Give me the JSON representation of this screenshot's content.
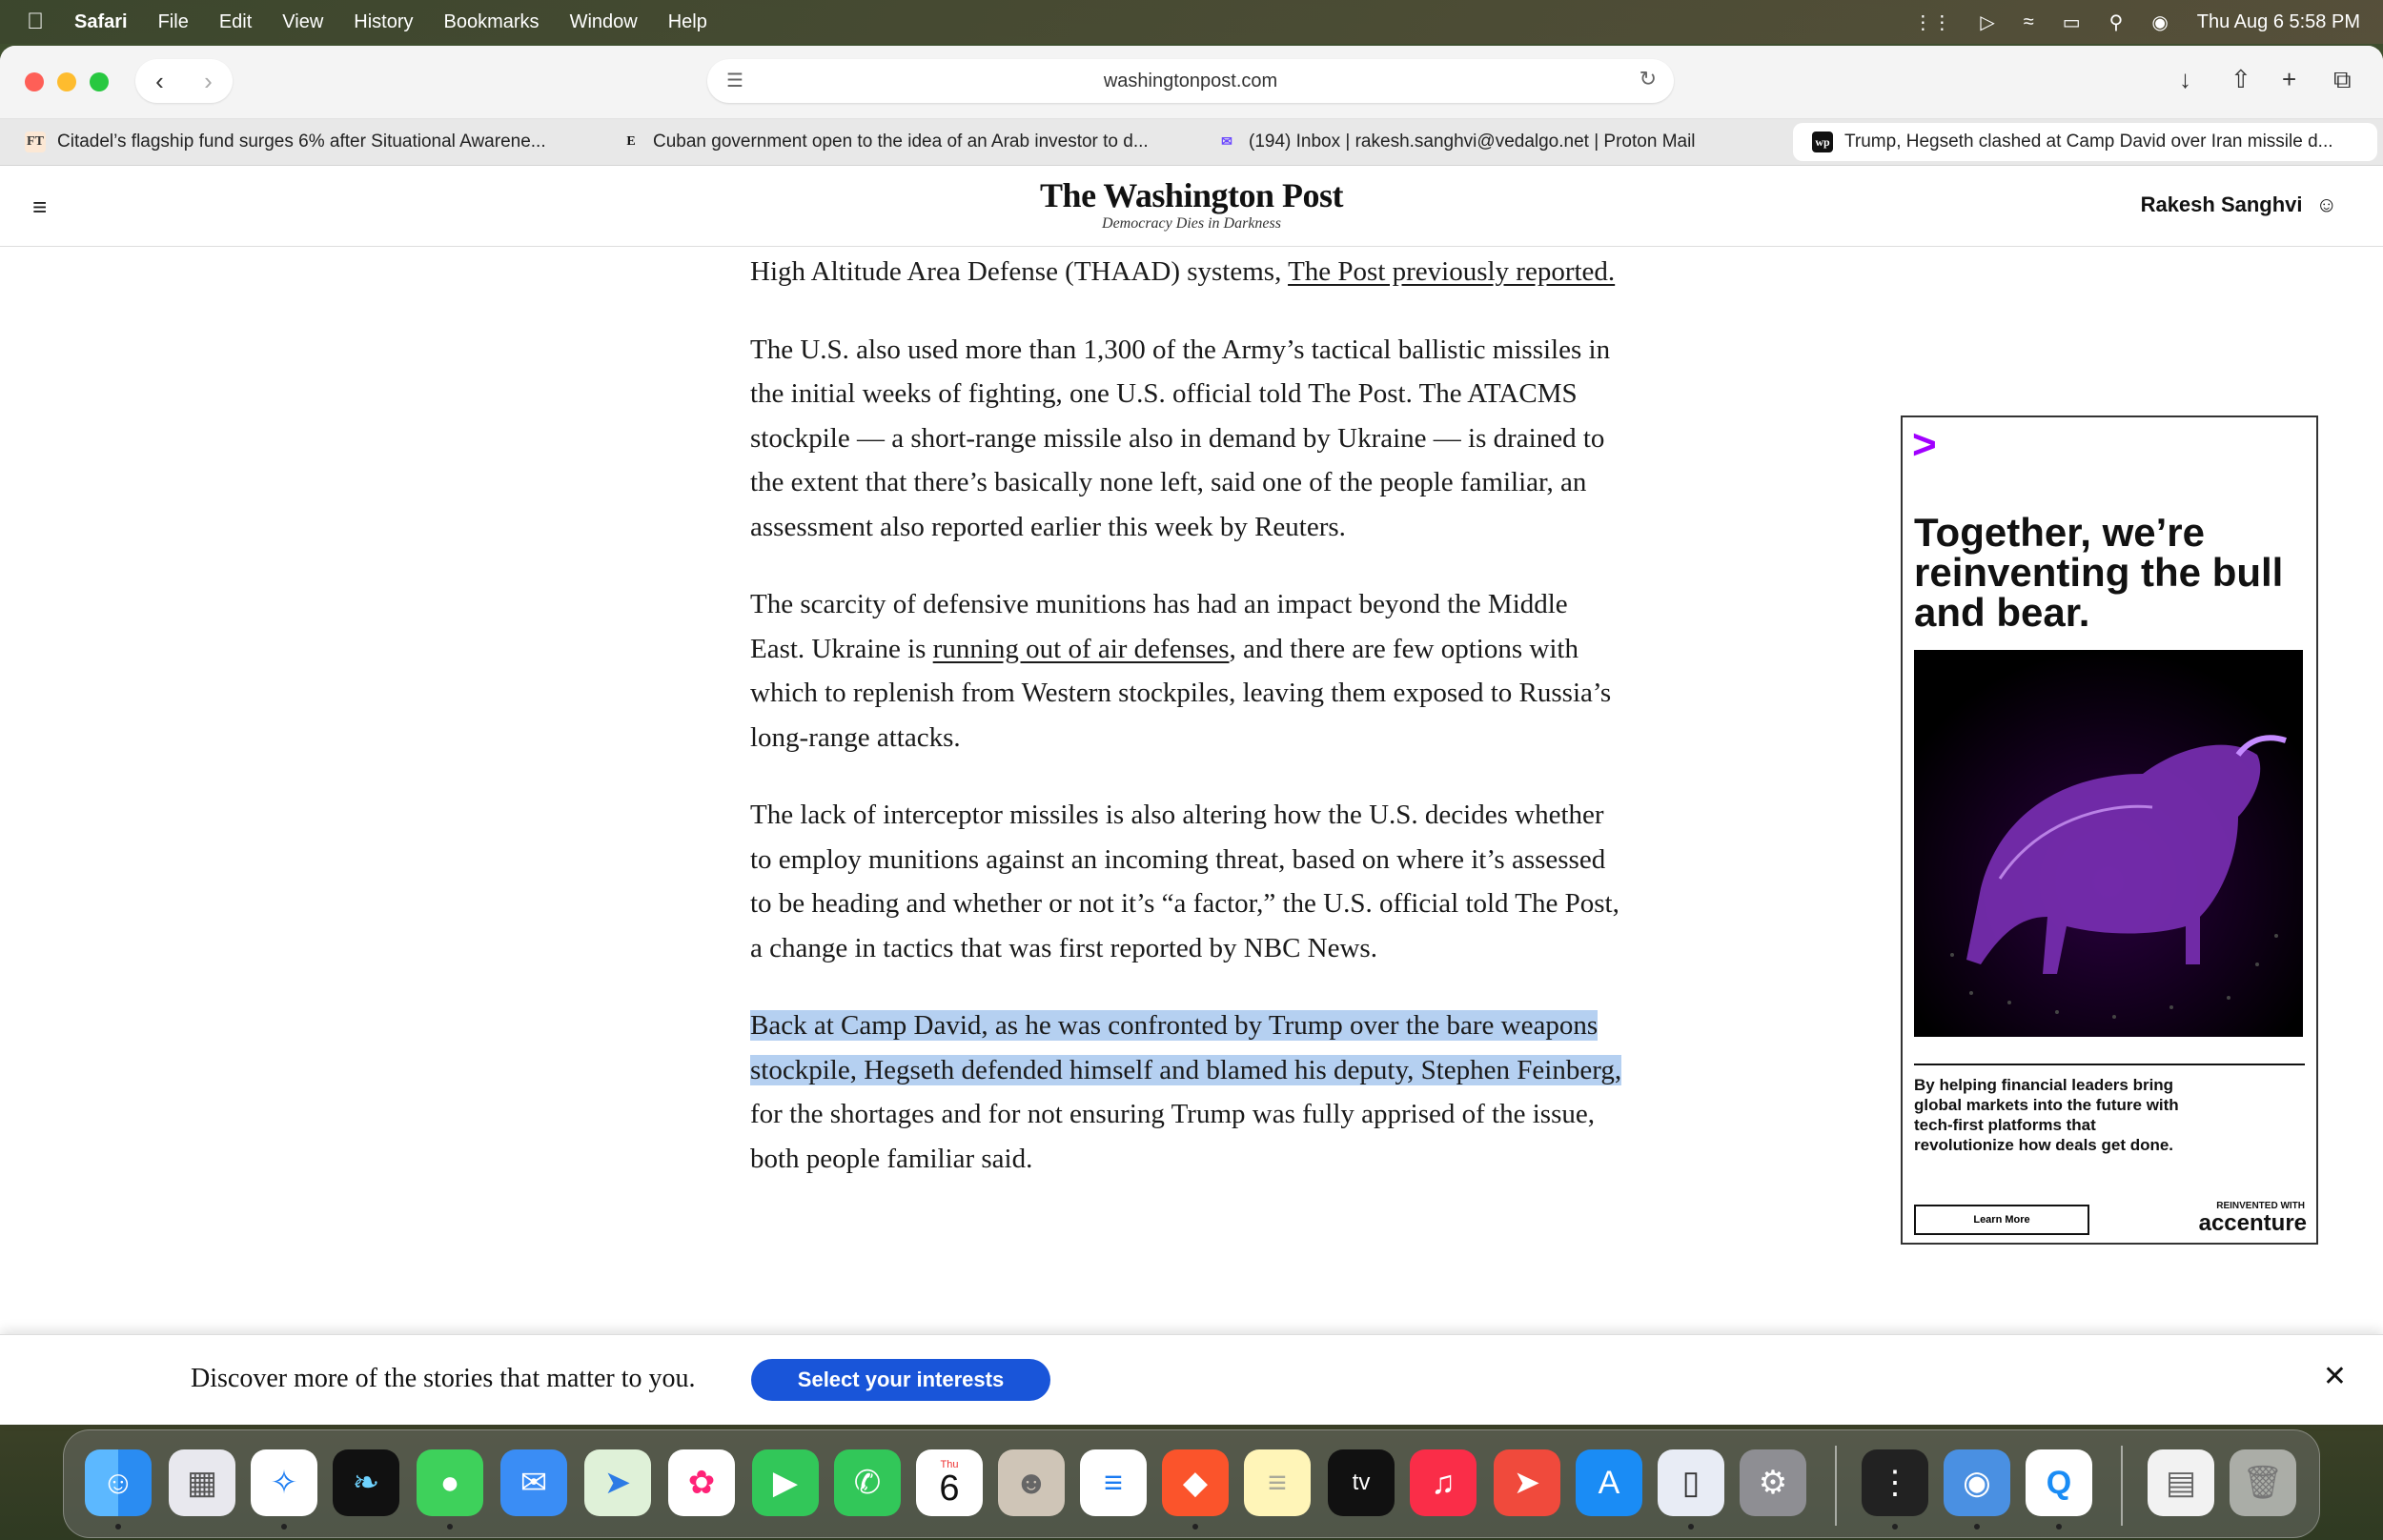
{
  "menubar": {
    "apple": "",
    "items": [
      "Safari",
      "File",
      "Edit",
      "View",
      "History",
      "Bookmarks",
      "Window",
      "Help"
    ],
    "datetime": "Thu Aug 6  5:58 PM"
  },
  "browser": {
    "url": "washingtonpost.com",
    "tabs": [
      {
        "favicon": "FT",
        "title": "Citadel’s flagship fund surges 6% after Situational Awarene..."
      },
      {
        "favicon": "E",
        "title": "Cuban government open to the idea of an Arab investor to d..."
      },
      {
        "favicon": "✉",
        "title": "(194) Inbox | rakesh.sanghvi@vedalgo.net | Proton Mail"
      },
      {
        "favicon": "wp",
        "title": "Trump, Hegseth clashed at Camp David over Iran missile d..."
      }
    ]
  },
  "site": {
    "name": "The Washington Post",
    "tagline": "Democracy Dies in Darkness",
    "user": "Rakesh Sanghvi"
  },
  "article": {
    "p1_text": "High Altitude Area Defense (THAAD) systems, ",
    "p1_link": "The Post previously reported.",
    "p2": "The U.S. also used more than 1,300 of the Army’s tactical ballistic missiles in the initial weeks of fighting, one U.S. official told The Post. The ATACMS stockpile — a short-range missile also in demand by Ukraine — is drained to the extent that there’s basically none left, said one of the people familiar, an assessment also reported earlier this week by Reuters.",
    "p3_a": "The scarcity of defensive munitions has had an impact beyond the Middle East. Ukraine is ",
    "p3_link": "running out of air defenses",
    "p3_b": ", and there are few options with which to replenish from Western stockpiles, leaving them exposed to Russia’s long-range attacks.",
    "p4": "The lack of interceptor missiles is also altering how the U.S. decides whether to employ munitions against an incoming threat, based on where it’s assessed to be heading and whether or not it’s “a factor,” the U.S. official told The Post, a change in tactics that was first reported by NBC News.",
    "p5_highlight": "Back at Camp David, as he was confronted by Trump over the bare weapons stockpile, Hegseth defended himself and blamed his deputy, Stephen Feinberg,",
    "p5_rest": " for the shortages and for not ensuring Trump was fully apprised of the issue, both people familiar said."
  },
  "ad": {
    "headline": "Together, we’re reinventing the bull and bear.",
    "body": "By helping financial leaders bring global markets into the future with tech-first platforms that revolutionize how deals get done.",
    "cta": "Learn More",
    "reinvented": "REINVENTED WITH",
    "brand": "accenture",
    "accent_color": "#a100ff"
  },
  "discover": {
    "text": "Discover more of the stories that matter to you.",
    "button": "Select your interests"
  },
  "dock": {
    "calendar_month": "Thu",
    "calendar_day": "6",
    "icons": [
      "finder-icon",
      "launchpad-icon",
      "safari-icon",
      "app-icon",
      "messages-icon",
      "mail-icon",
      "maps-icon",
      "photos-icon",
      "facetime-icon",
      "phone-icon",
      "calendar-icon",
      "contacts-icon",
      "reminders-icon",
      "brave-icon",
      "notes-icon",
      "appletv-icon",
      "music-icon",
      "rocket-icon",
      "appstore-icon",
      "simulator-icon",
      "settings-icon",
      "launcher-icon",
      "disk-icon",
      "q-icon",
      "window-icon",
      "trash-icon"
    ]
  }
}
